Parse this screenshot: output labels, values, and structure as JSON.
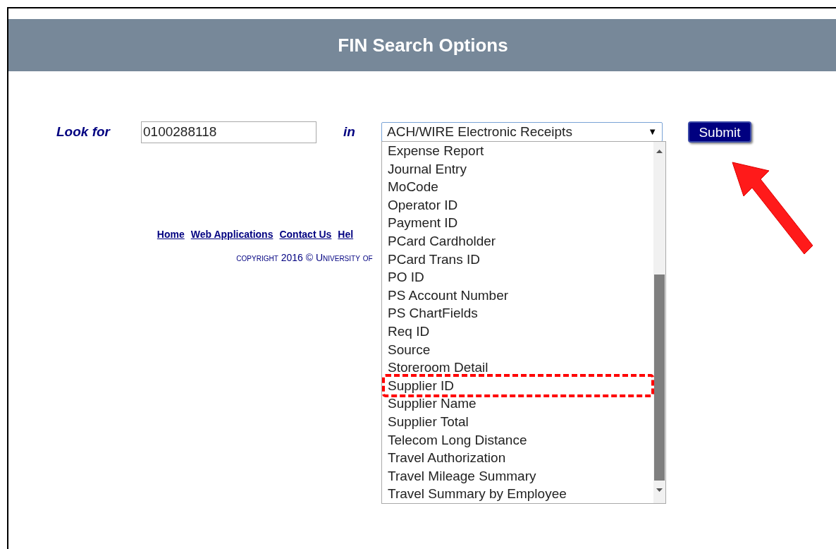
{
  "header": {
    "title": "FIN Search Options"
  },
  "search": {
    "label": "Look for",
    "value": "0100288118"
  },
  "in_label": "in",
  "select": {
    "value": "ACH/WIRE Electronic Receipts",
    "arrow": "▼",
    "options": [
      {
        "label": "Expense Report",
        "annotated": false
      },
      {
        "label": "Journal Entry",
        "annotated": false
      },
      {
        "label": "MoCode",
        "annotated": false
      },
      {
        "label": "Operator ID",
        "annotated": false
      },
      {
        "label": "Payment ID",
        "annotated": false
      },
      {
        "label": "PCard Cardholder",
        "annotated": false
      },
      {
        "label": "PCard Trans ID",
        "annotated": false
      },
      {
        "label": "PO ID",
        "annotated": false
      },
      {
        "label": "PS Account Number",
        "annotated": false
      },
      {
        "label": "PS ChartFields",
        "annotated": false
      },
      {
        "label": "Req ID",
        "annotated": false
      },
      {
        "label": "Source",
        "annotated": false
      },
      {
        "label": "Storeroom Detail",
        "annotated": false
      },
      {
        "label": "Supplier ID",
        "annotated": true
      },
      {
        "label": "Supplier Name",
        "annotated": false
      },
      {
        "label": "Supplier Total",
        "annotated": false
      },
      {
        "label": "Telecom Long Distance",
        "annotated": false
      },
      {
        "label": "Travel Authorization",
        "annotated": false
      },
      {
        "label": "Travel Mileage Summary",
        "annotated": false
      },
      {
        "label": "Travel Summary by Employee",
        "annotated": false
      }
    ]
  },
  "submit": {
    "label": "Submit",
    "annotated": true
  },
  "footer": {
    "links": [
      "Home",
      "Web Applications",
      "Contact Us",
      "Hel"
    ],
    "copyright": "copyright 2016 © University of"
  }
}
